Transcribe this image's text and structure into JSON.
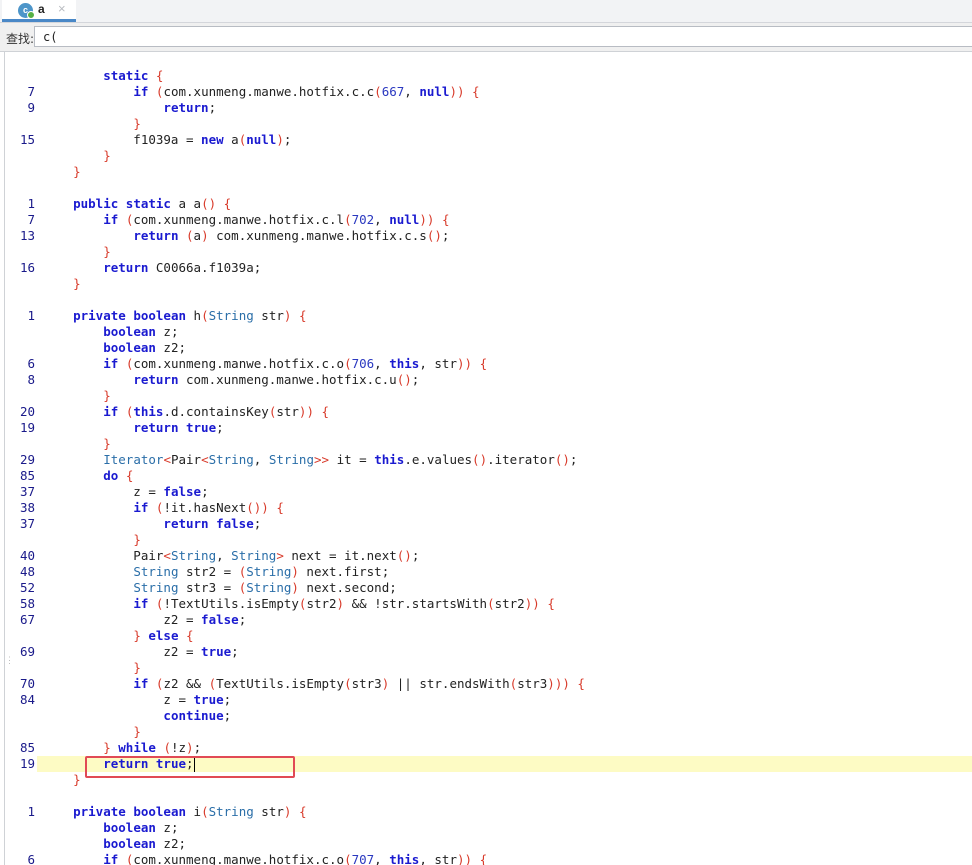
{
  "tab": {
    "icon_letter": "c",
    "label": "a",
    "close": "×"
  },
  "find": {
    "label": "查找:",
    "value": "c("
  },
  "lines": [
    {
      "num": "",
      "text": ""
    },
    {
      "num": "",
      "text": "        static {"
    },
    {
      "num": "7",
      "text": "            if (com.xunmeng.manwe.hotfix.c.c(667, null)) {"
    },
    {
      "num": "9",
      "text": "                return;"
    },
    {
      "num": "",
      "text": "            }"
    },
    {
      "num": "15",
      "text": "            f1039a = new a(null);"
    },
    {
      "num": "",
      "text": "        }"
    },
    {
      "num": "",
      "text": "    }"
    },
    {
      "num": "",
      "text": ""
    },
    {
      "num": "1",
      "text": "    public static a a() {"
    },
    {
      "num": "7",
      "text": "        if (com.xunmeng.manwe.hotfix.c.l(702, null)) {"
    },
    {
      "num": "13",
      "text": "            return (a) com.xunmeng.manwe.hotfix.c.s();"
    },
    {
      "num": "",
      "text": "        }"
    },
    {
      "num": "16",
      "text": "        return C0066a.f1039a;"
    },
    {
      "num": "",
      "text": "    }"
    },
    {
      "num": "",
      "text": ""
    },
    {
      "num": "1",
      "text": "    private boolean h(String str) {"
    },
    {
      "num": "",
      "text": "        boolean z;"
    },
    {
      "num": "",
      "text": "        boolean z2;"
    },
    {
      "num": "6",
      "text": "        if (com.xunmeng.manwe.hotfix.c.o(706, this, str)) {"
    },
    {
      "num": "8",
      "text": "            return com.xunmeng.manwe.hotfix.c.u();"
    },
    {
      "num": "",
      "text": "        }"
    },
    {
      "num": "20",
      "text": "        if (this.d.containsKey(str)) {"
    },
    {
      "num": "19",
      "text": "            return true;"
    },
    {
      "num": "",
      "text": "        }"
    },
    {
      "num": "29",
      "text": "        Iterator<Pair<String, String>> it = this.e.values().iterator();"
    },
    {
      "num": "85",
      "text": "        do {"
    },
    {
      "num": "37",
      "text": "            z = false;"
    },
    {
      "num": "38",
      "text": "            if (!it.hasNext()) {"
    },
    {
      "num": "37",
      "text": "                return false;"
    },
    {
      "num": "",
      "text": "            }"
    },
    {
      "num": "40",
      "text": "            Pair<String, String> next = it.next();"
    },
    {
      "num": "48",
      "text": "            String str2 = (String) next.first;"
    },
    {
      "num": "52",
      "text": "            String str3 = (String) next.second;"
    },
    {
      "num": "58",
      "text": "            if (!TextUtils.isEmpty(str2) && !str.startsWith(str2)) {"
    },
    {
      "num": "67",
      "text": "                z2 = false;"
    },
    {
      "num": "",
      "text": "            } else {"
    },
    {
      "num": "69",
      "text": "                z2 = true;"
    },
    {
      "num": "",
      "text": "            }"
    },
    {
      "num": "70",
      "text": "            if (z2 && (TextUtils.isEmpty(str3) || str.endsWith(str3))) {"
    },
    {
      "num": "84",
      "text": "                z = true;"
    },
    {
      "num": "",
      "text": "                continue;"
    },
    {
      "num": "",
      "text": "            }"
    },
    {
      "num": "85",
      "text": "        } while (!z);"
    },
    {
      "num": "19",
      "text": "        return true;",
      "highlight": true
    },
    {
      "num": "",
      "text": "    }"
    },
    {
      "num": "",
      "text": ""
    },
    {
      "num": "1",
      "text": "    private boolean i(String str) {"
    },
    {
      "num": "",
      "text": "        boolean z;"
    },
    {
      "num": "",
      "text": "        boolean z2;"
    },
    {
      "num": "6",
      "text": "        if (com.xunmeng.manwe.hotfix.c.o(707, this, str)) {"
    }
  ],
  "colors": {
    "keyword": "#1a1ad0",
    "type": "#2a6ea8",
    "paren": "#d83a2a",
    "number": "#2a38c0",
    "line_number": "#1a1a8a",
    "highlight": "#fdfbc4",
    "selection_box": "#e14a55"
  }
}
